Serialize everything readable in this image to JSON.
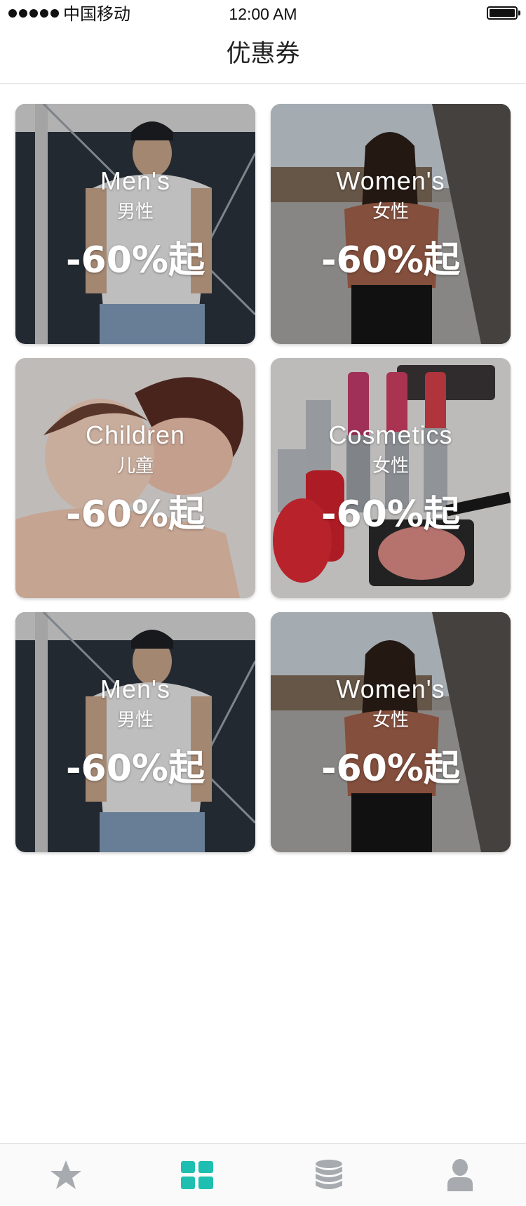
{
  "status_bar": {
    "carrier": "中国移动",
    "time": "12:00 AM"
  },
  "nav": {
    "title": "优惠券"
  },
  "coupons": [
    {
      "title": "Men's",
      "subtitle": "男性",
      "discount": "-60%起",
      "photo": "man-in-white-tee-photo"
    },
    {
      "title": "Women's",
      "subtitle": "女性",
      "discount": "-60%起",
      "photo": "woman-in-brown-top-photo"
    },
    {
      "title": "Children",
      "subtitle": "儿童",
      "discount": "-60%起",
      "photo": "mother-and-baby-photo"
    },
    {
      "title": "Cosmetics",
      "subtitle": "女性",
      "discount": "-60%起",
      "photo": "lipsticks-and-nail-polish-photo"
    },
    {
      "title": "Men's",
      "subtitle": "男性",
      "discount": "-60%起",
      "photo": "man-in-white-tee-photo"
    },
    {
      "title": "Women's",
      "subtitle": "女性",
      "discount": "-60%起",
      "photo": "woman-in-brown-top-photo"
    }
  ],
  "tab_bar": {
    "items": [
      {
        "icon": "star-icon",
        "active": false
      },
      {
        "icon": "grid-icon",
        "active": true
      },
      {
        "icon": "database-icon",
        "active": false
      },
      {
        "icon": "user-icon",
        "active": false
      }
    ],
    "active_color": "#1ebfb0",
    "inactive_color": "#a7abb0"
  },
  "colors": {
    "overlay_text": "#ffffff",
    "nav_divider": "#e9e9e9"
  }
}
